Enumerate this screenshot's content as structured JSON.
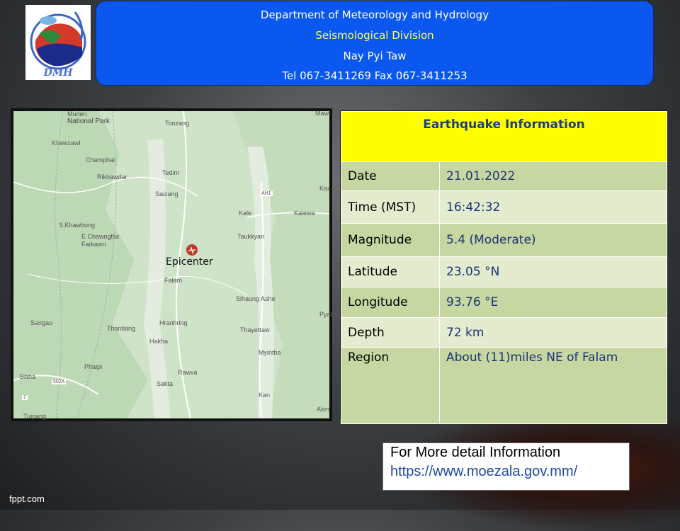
{
  "logo": {
    "text": "DMH"
  },
  "header": {
    "line1": "Department of Meteorology and Hydrology",
    "line2": "Seismological Division",
    "line3": "Nay Pyi Taw",
    "line4": "Tel 067-3411269 Fax 067-3411253"
  },
  "map": {
    "epicenter_label": "Epicenter",
    "places": [
      "Murlen",
      "National Park",
      "Tonzang",
      "Khawzawl",
      "Champhai",
      "Rikhawdar",
      "Tedim",
      "Saizang",
      "Kale",
      "Kalewa",
      "S.Khawbung",
      "E Chawngtlui",
      "Farkawn",
      "Taukkyan",
      "Falam",
      "Sihaung Ashe",
      "Sangau",
      "Hranhring",
      "Thantlang",
      "Hakha",
      "Thayettaw",
      "Myintha",
      "Phaipi",
      "Rawva",
      "Sakta",
      "Kan",
      "Siaha",
      "Tuipang",
      "Mawl",
      "Kaz",
      "Pyatho",
      "Alon",
      "AH1",
      "502A",
      "2"
    ]
  },
  "info": {
    "heading": "Earthquake Information",
    "rows": [
      {
        "key": "Date",
        "value": "21.01.2022"
      },
      {
        "key": "Time (MST)",
        "value": "16:42:32"
      },
      {
        "key": "Magnitude",
        "value": "5.4 (Moderate)"
      },
      {
        "key": "Latitude",
        "value": "23.05 °N"
      },
      {
        "key": "Longitude",
        "value": "93.76 °E"
      },
      {
        "key": "Depth",
        "value": "72 km"
      },
      {
        "key": "Region",
        "value": "About (11)miles NE of Falam"
      }
    ]
  },
  "detail": {
    "line1": "For More detail Information",
    "link": "https://www.moezala.gov.mm/"
  },
  "footer": {
    "brand": "fppt.com"
  },
  "colors": {
    "header_bg": "#0a58f0",
    "table_heading_bg": "#ffff00",
    "row_dark": "#c6d7a2",
    "row_light": "#e3ecce",
    "epicenter": "#c0392b"
  }
}
